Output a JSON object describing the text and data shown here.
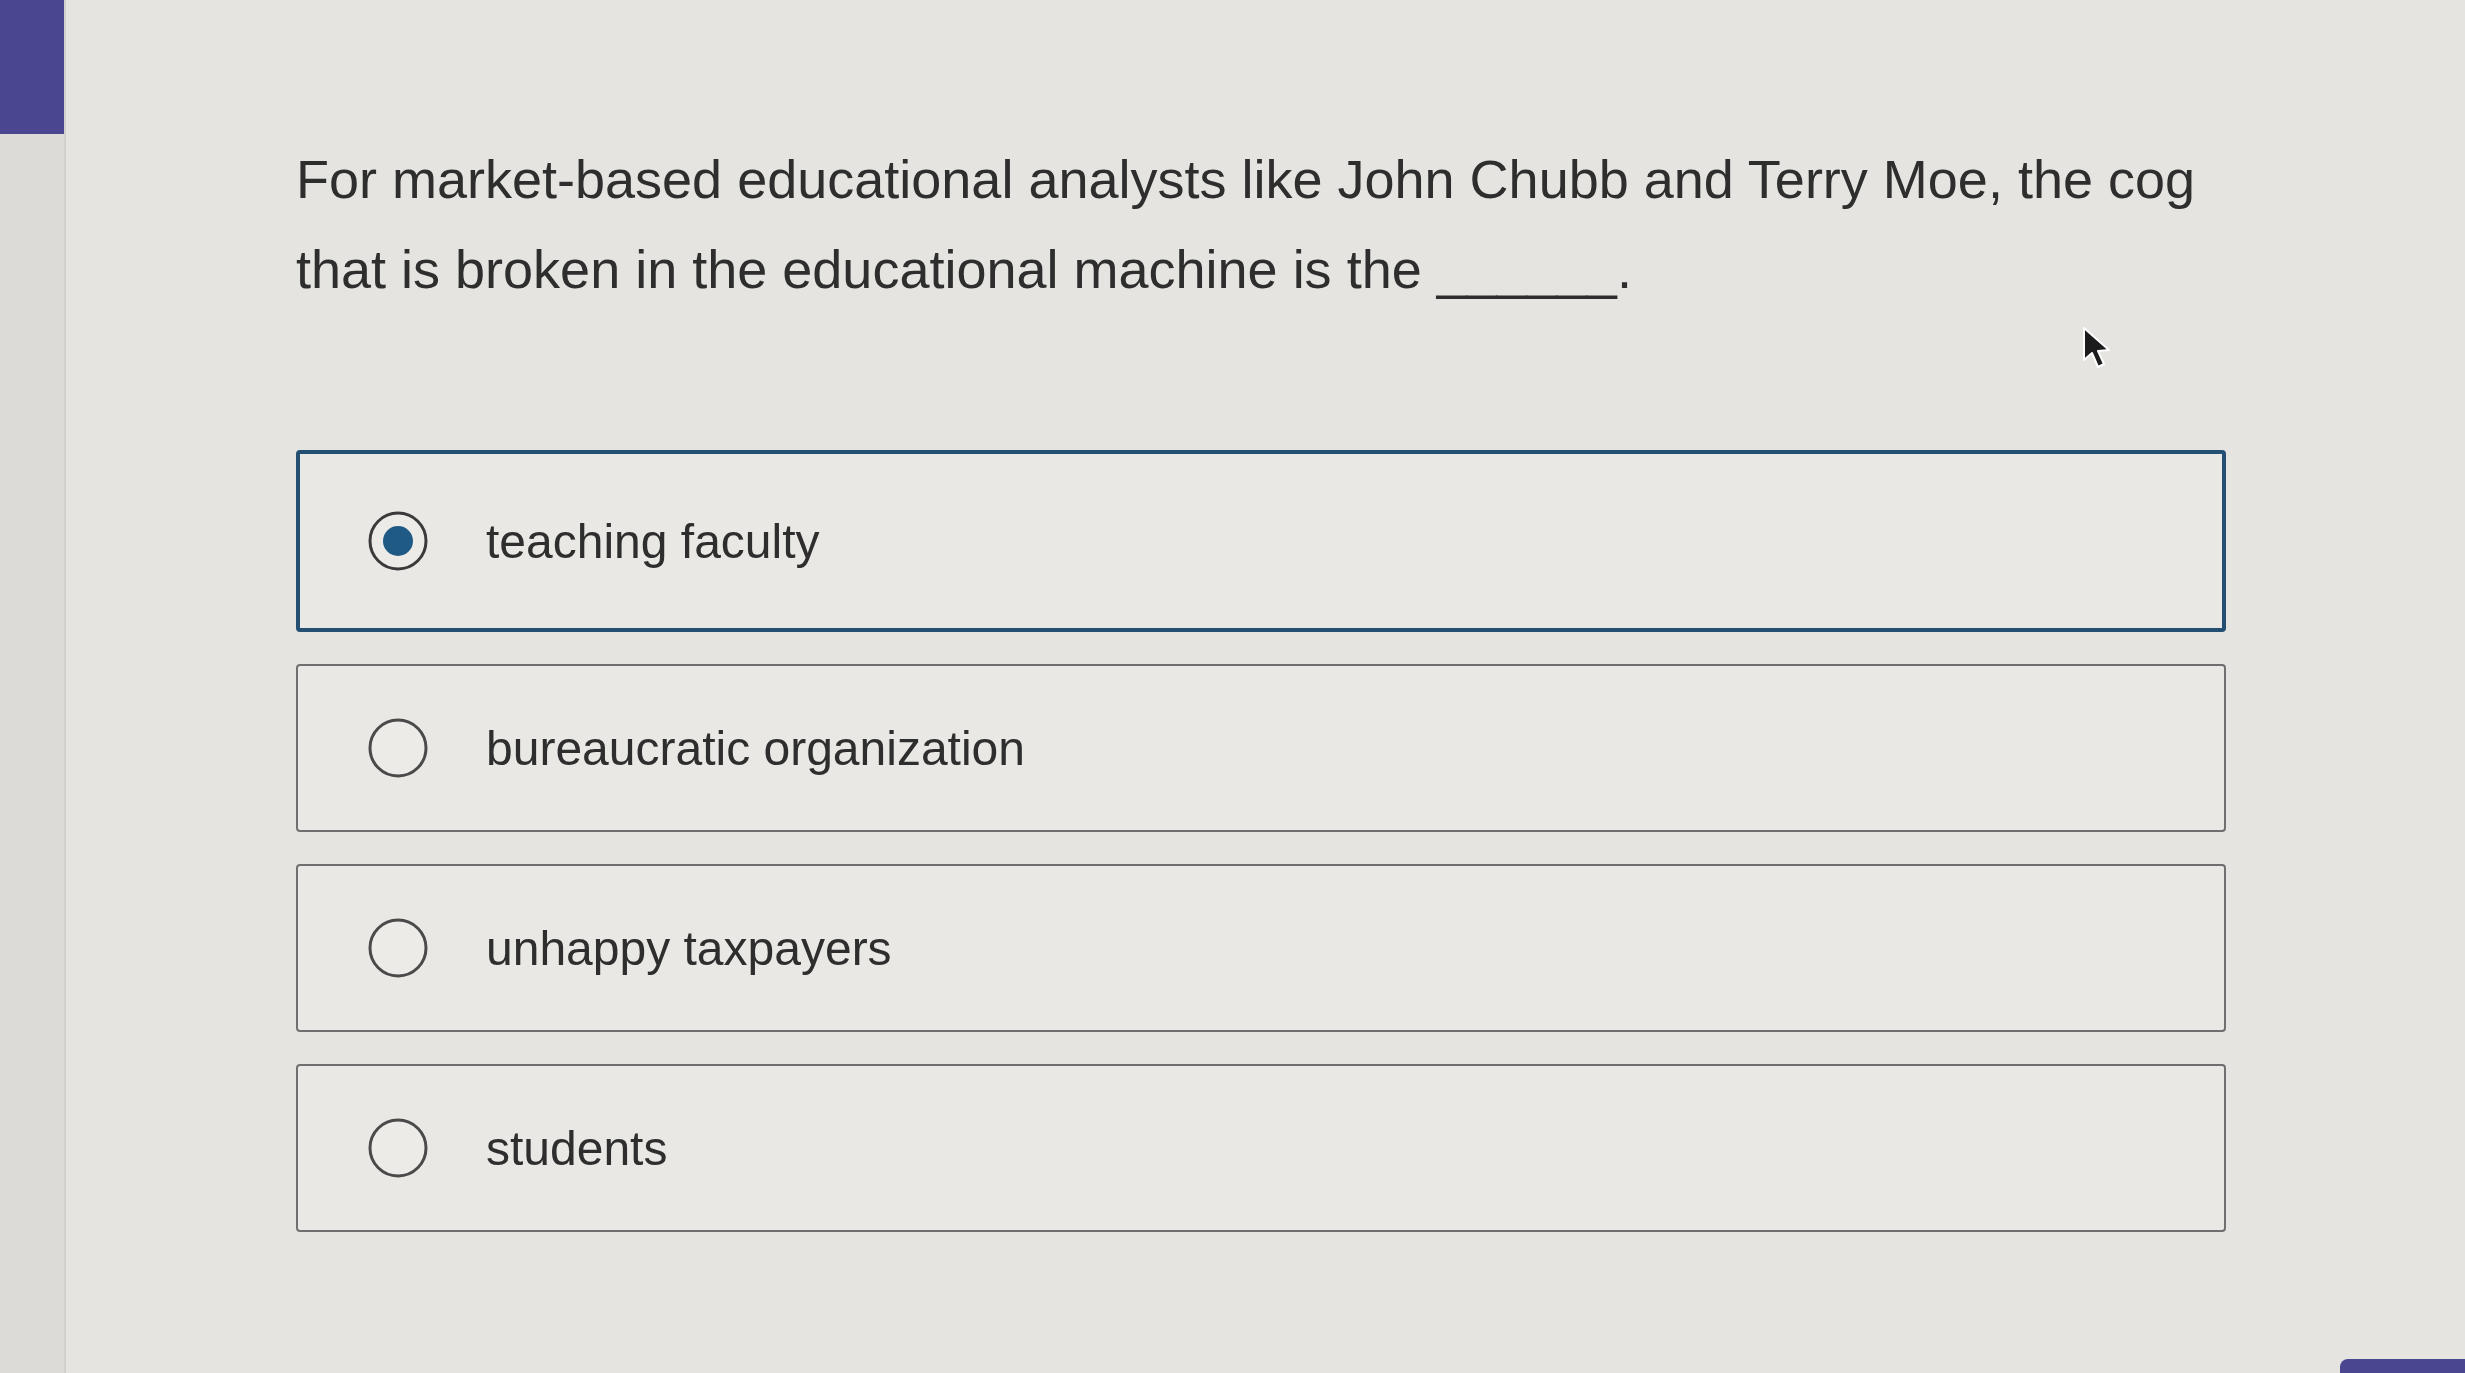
{
  "question": {
    "text": "For market-based educational analysts like John Chubb and Terry Moe, the cog that is broken in the educational machine is the ______."
  },
  "options": [
    {
      "label": "teaching faculty",
      "selected": true
    },
    {
      "label": "bureaucratic organization",
      "selected": false
    },
    {
      "label": "unhappy taxpayers",
      "selected": false
    },
    {
      "label": "students",
      "selected": false
    }
  ]
}
